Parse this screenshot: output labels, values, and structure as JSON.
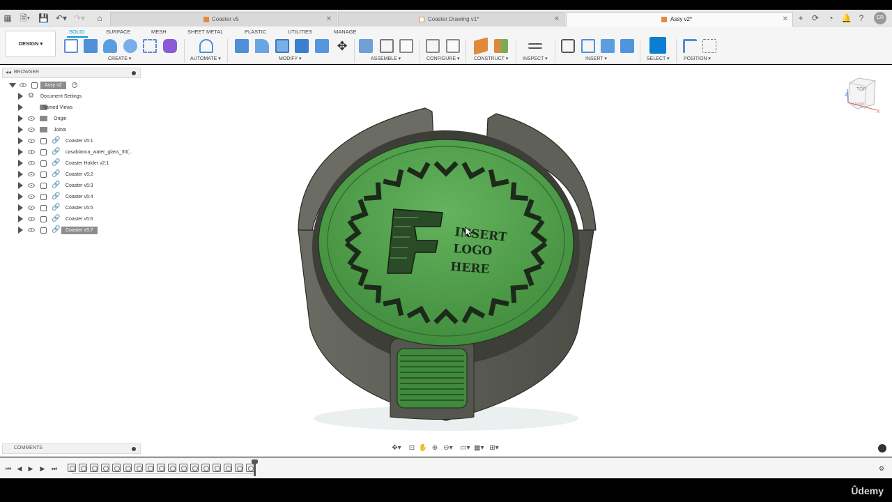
{
  "tabs": [
    {
      "label": "Coaster v5",
      "active": false,
      "icon": "part-icon"
    },
    {
      "label": "Coaster Drawing v1*",
      "active": false,
      "icon": "drawing-icon"
    },
    {
      "label": "Assy v2*",
      "active": true,
      "icon": "part-icon"
    }
  ],
  "titlebar": {
    "user_initials": "CR"
  },
  "toolbar": {
    "workspace": "DESIGN ▾",
    "tabs": [
      "SOLID",
      "SURFACE",
      "MESH",
      "SHEET METAL",
      "PLASTIC",
      "UTILITIES",
      "MANAGE"
    ],
    "active_tab": "SOLID",
    "groups": [
      "CREATE ▾",
      "AUTOMATE ▾",
      "MODIFY ▾",
      "ASSEMBLE ▾",
      "CONFIGURE ▾",
      "CONSTRUCT ▾",
      "INSPECT ▾",
      "INSERT ▾",
      "SELECT ▾",
      "POSITION ▾"
    ]
  },
  "browser": {
    "title": "BROWSER",
    "root": "Assy v2",
    "items": [
      {
        "label": "Document Settings",
        "icon": "gear-icon",
        "visible": false
      },
      {
        "label": "Named Views",
        "icon": "folder-icon",
        "visible": false
      },
      {
        "label": "Origin",
        "icon": "folder-icon",
        "visible": true
      },
      {
        "label": "Joints",
        "icon": "folder-icon",
        "visible": true
      },
      {
        "label": "Coaster v5:1",
        "icon": "component-link-icon",
        "visible": true
      },
      {
        "label": "casablanca_water_glass_30(...",
        "icon": "component-link-icon",
        "visible": true
      },
      {
        "label": "Coaster Holder v2:1",
        "icon": "component-link-icon",
        "visible": true
      },
      {
        "label": "Coaster v5:2",
        "icon": "component-link-icon",
        "visible": true
      },
      {
        "label": "Coaster v5:3",
        "icon": "component-link-icon",
        "visible": true
      },
      {
        "label": "Coaster v5:4",
        "icon": "component-link-icon",
        "visible": true
      },
      {
        "label": "Coaster v5:5",
        "icon": "component-link-icon",
        "visible": true
      },
      {
        "label": "Coaster v5:6",
        "icon": "component-link-icon",
        "visible": true
      },
      {
        "label": "Coaster v5:7",
        "icon": "component-link-icon",
        "visible": true,
        "highlighted": true
      }
    ]
  },
  "viewcube": {
    "top": "TOP",
    "front": "FRONT"
  },
  "model": {
    "engraving": [
      "INSERT",
      "LOGO",
      "HERE"
    ],
    "coaster_color": "#4c9a47",
    "holder_color": "#56574f"
  },
  "comments": {
    "title": "COMMENTS"
  },
  "watermark": "Ûdemy"
}
